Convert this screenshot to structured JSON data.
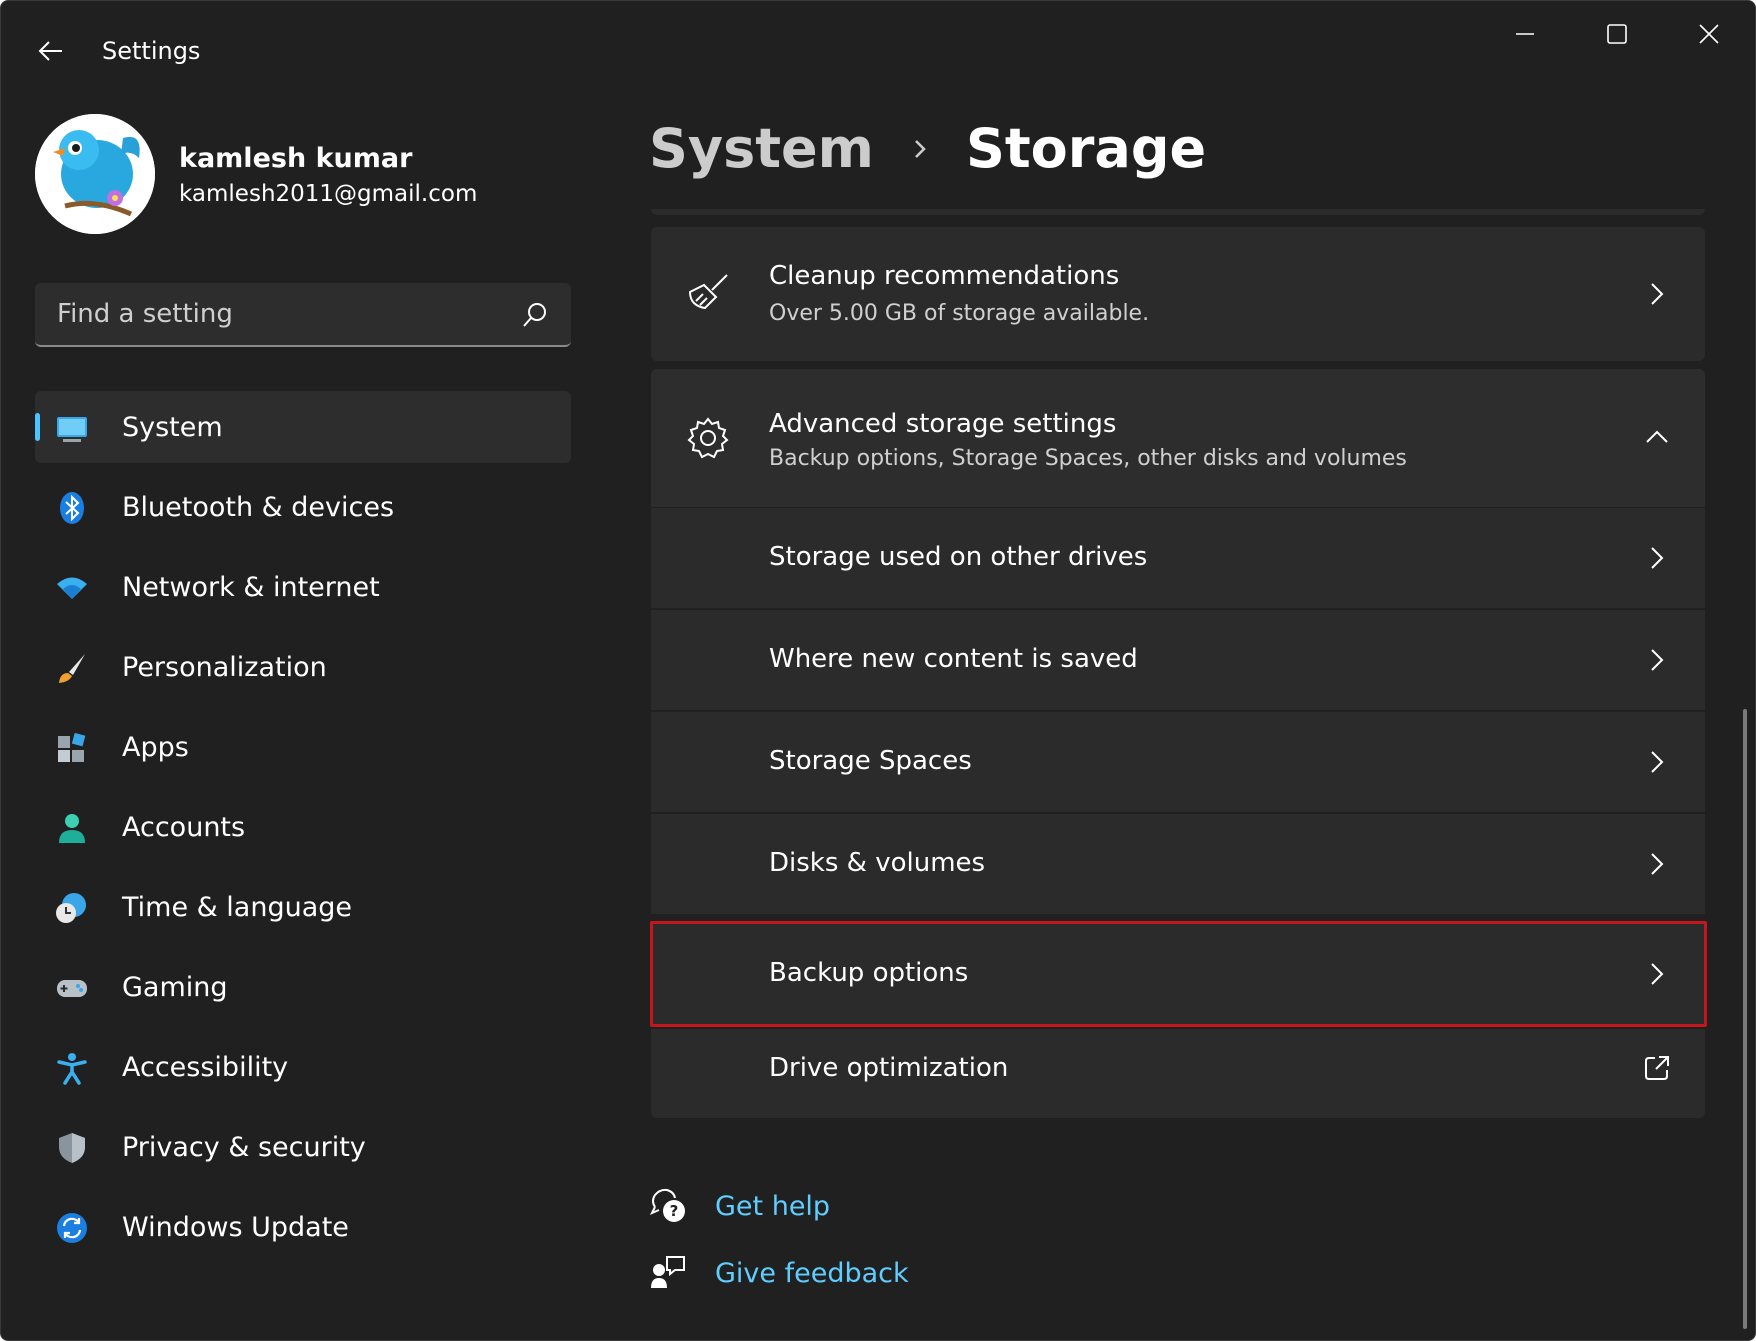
{
  "app": {
    "title": "Settings"
  },
  "profile": {
    "name": "kamlesh kumar",
    "email": "kamlesh2011@gmail.com"
  },
  "search": {
    "placeholder": "Find a setting"
  },
  "nav": {
    "items": [
      {
        "label": "System",
        "icon": "system-icon",
        "active": true
      },
      {
        "label": "Bluetooth & devices",
        "icon": "bluetooth-icon"
      },
      {
        "label": "Network & internet",
        "icon": "wifi-icon"
      },
      {
        "label": "Personalization",
        "icon": "brush-icon"
      },
      {
        "label": "Apps",
        "icon": "apps-icon"
      },
      {
        "label": "Accounts",
        "icon": "person-icon"
      },
      {
        "label": "Time & language",
        "icon": "clock-globe-icon"
      },
      {
        "label": "Gaming",
        "icon": "gamepad-icon"
      },
      {
        "label": "Accessibility",
        "icon": "accessibility-icon"
      },
      {
        "label": "Privacy & security",
        "icon": "shield-icon"
      },
      {
        "label": "Windows Update",
        "icon": "update-icon"
      }
    ]
  },
  "breadcrumb": {
    "parent": "System",
    "current": "Storage"
  },
  "cleanup": {
    "title": "Cleanup recommendations",
    "subtitle": "Over 5.00 GB of storage available."
  },
  "advanced": {
    "title": "Advanced storage settings",
    "subtitle": "Backup options, Storage Spaces, other disks and volumes",
    "items": [
      {
        "label": "Storage used on other drives",
        "icon": "chevron-right-icon"
      },
      {
        "label": "Where new content is saved",
        "icon": "chevron-right-icon"
      },
      {
        "label": "Storage Spaces",
        "icon": "chevron-right-icon"
      },
      {
        "label": "Disks & volumes",
        "icon": "chevron-right-icon"
      },
      {
        "label": "Backup options",
        "icon": "chevron-right-icon",
        "highlighted": true
      },
      {
        "label": "Drive optimization",
        "icon": "external-link-icon"
      }
    ]
  },
  "help": {
    "get_help": "Get help",
    "give_feedback": "Give feedback"
  },
  "colors": {
    "accent": "#4cc2ff",
    "link": "#60cdff",
    "highlight_border": "#c4161c",
    "background": "#202020",
    "card": "#2b2b2b"
  }
}
